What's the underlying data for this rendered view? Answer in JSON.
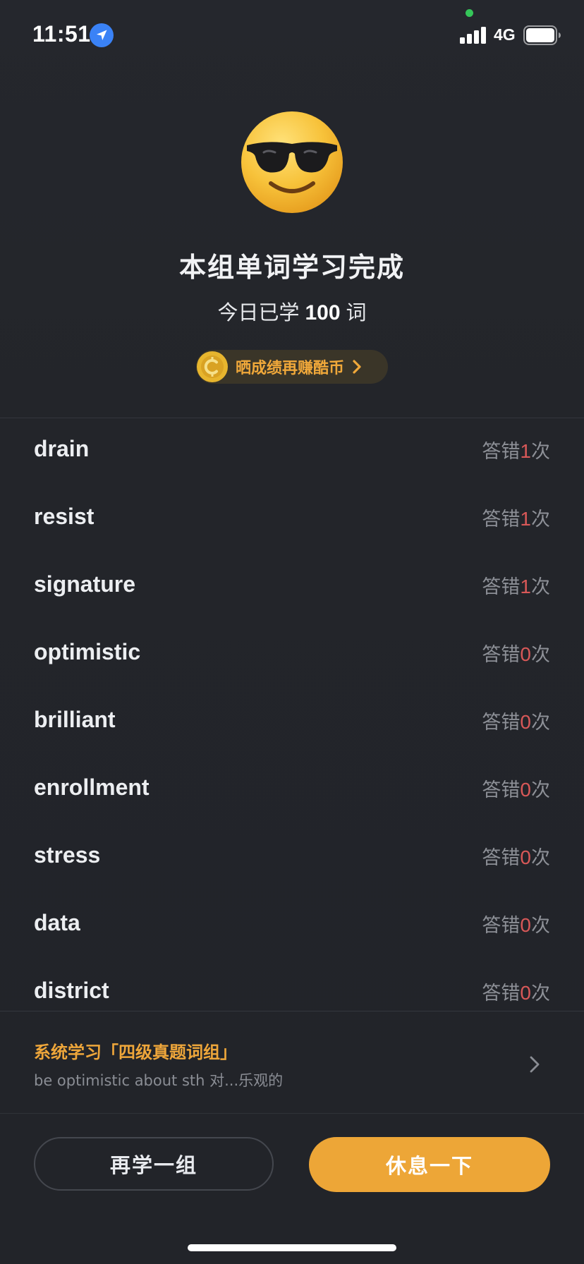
{
  "status_bar": {
    "time": "11:51",
    "network": "4G",
    "icons": [
      "location-arrow-icon",
      "signal-bars-icon",
      "battery-icon"
    ]
  },
  "summary": {
    "emoji": "sunglasses-face-icon",
    "title": "本组单词学习完成",
    "today_prefix": "今日已学",
    "today_count": "100",
    "today_suffix": "词",
    "share": {
      "icon": "coin-icon",
      "label": "晒成绩再赚酷币"
    }
  },
  "words": [
    {
      "word": "drain",
      "prefix": "答错",
      "count": "1",
      "suffix": "次"
    },
    {
      "word": "resist",
      "prefix": "答错",
      "count": "1",
      "suffix": "次"
    },
    {
      "word": "signature",
      "prefix": "答错",
      "count": "1",
      "suffix": "次"
    },
    {
      "word": "optimistic",
      "prefix": "答错",
      "count": "0",
      "suffix": "次"
    },
    {
      "word": "brilliant",
      "prefix": "答错",
      "count": "0",
      "suffix": "次"
    },
    {
      "word": "enrollment",
      "prefix": "答错",
      "count": "0",
      "suffix": "次"
    },
    {
      "word": "stress",
      "prefix": "答错",
      "count": "0",
      "suffix": "次"
    },
    {
      "word": "data",
      "prefix": "答错",
      "count": "0",
      "suffix": "次"
    },
    {
      "word": "district",
      "prefix": "答错",
      "count": "0",
      "suffix": "次"
    }
  ],
  "system_study": {
    "title": "系统学习「四级真题词组」",
    "subtitle": "be optimistic about sth 对...乐观的"
  },
  "buttons": {
    "again": "再学一组",
    "rest": "休息一下"
  },
  "colors": {
    "background": "#23252b",
    "accent": "#eda637",
    "wrong_count": "#d85858",
    "muted_text": "#8d9097"
  }
}
